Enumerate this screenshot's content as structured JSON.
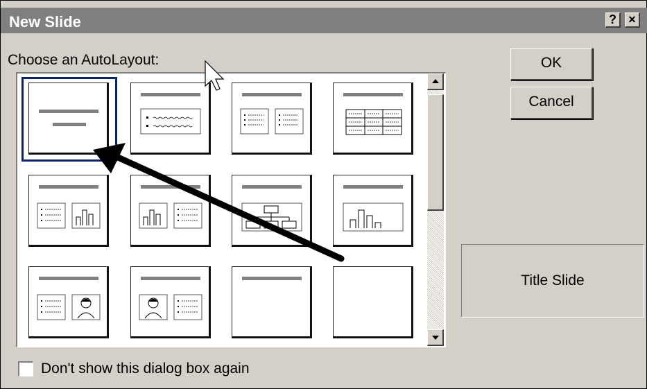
{
  "window": {
    "title": "New Slide",
    "help_glyph": "?",
    "close_glyph": "×",
    "background_color": "#d4d0c8",
    "titlebar_color": "#808080"
  },
  "prompt": "Choose an AutoLayout:",
  "layouts": [
    {
      "name": "title-slide",
      "icon": "title-slide-layout-icon",
      "selected": true
    },
    {
      "name": "bulleted-list",
      "icon": "bulleted-list-layout-icon"
    },
    {
      "name": "two-column-text",
      "icon": "two-column-text-layout-icon"
    },
    {
      "name": "table",
      "icon": "table-layout-icon"
    },
    {
      "name": "text-and-chart",
      "icon": "text-and-chart-layout-icon"
    },
    {
      "name": "chart-and-text",
      "icon": "chart-and-text-layout-icon"
    },
    {
      "name": "organization-chart",
      "icon": "organization-chart-layout-icon"
    },
    {
      "name": "chart",
      "icon": "chart-layout-icon"
    },
    {
      "name": "text-and-clip-art",
      "icon": "text-and-clip-art-layout-icon"
    },
    {
      "name": "clip-art-and-text",
      "icon": "clip-art-and-text-layout-icon"
    },
    {
      "name": "title-only",
      "icon": "title-only-layout-icon"
    },
    {
      "name": "blank",
      "icon": "blank-layout-icon"
    }
  ],
  "buttons": {
    "ok": "OK",
    "cancel": "Cancel"
  },
  "preview": {
    "label": "Title Slide"
  },
  "checkbox": {
    "label": "Don't show this dialog box again",
    "checked": false
  },
  "annotation": {
    "icon": "annotation-arrow-icon",
    "color": "#000000"
  },
  "selection_color": "#0a246a"
}
